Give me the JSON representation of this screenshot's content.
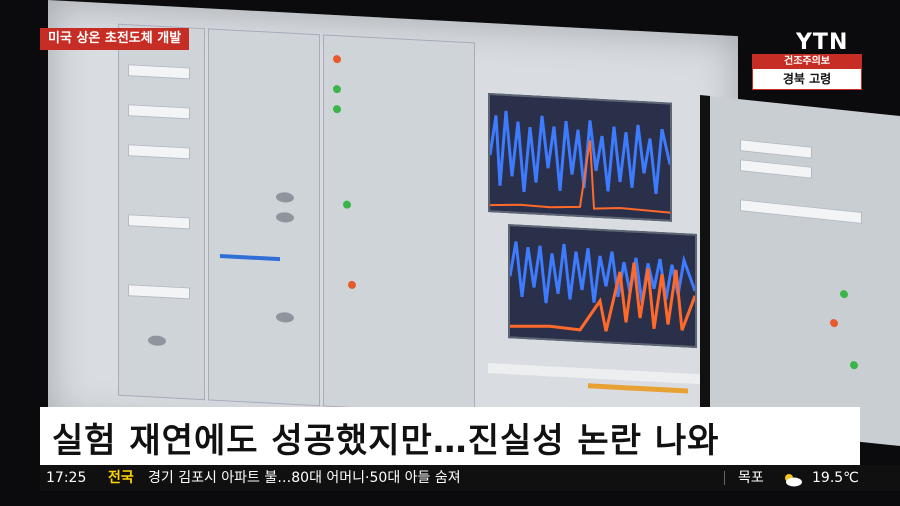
{
  "top_tag": "미국 상온 초전도체 개발",
  "logo": "YTN",
  "alert": {
    "title": "건조주의보",
    "region": "경북 고령"
  },
  "headline": "실험 재연에도 성공했지만…진실성 논란 나와",
  "ticker": {
    "time": "17:25",
    "region": "전국",
    "news": "경기 김포시 아파트 불…80대 어머니·50대 아들 숨져",
    "city": "목포",
    "weather_icon": "partly-cloudy-icon",
    "temperature": "19.5℃"
  },
  "colors": {
    "accent_red": "#c62d24",
    "ticker_bg": "#101010",
    "region_yellow": "#ffd400"
  }
}
